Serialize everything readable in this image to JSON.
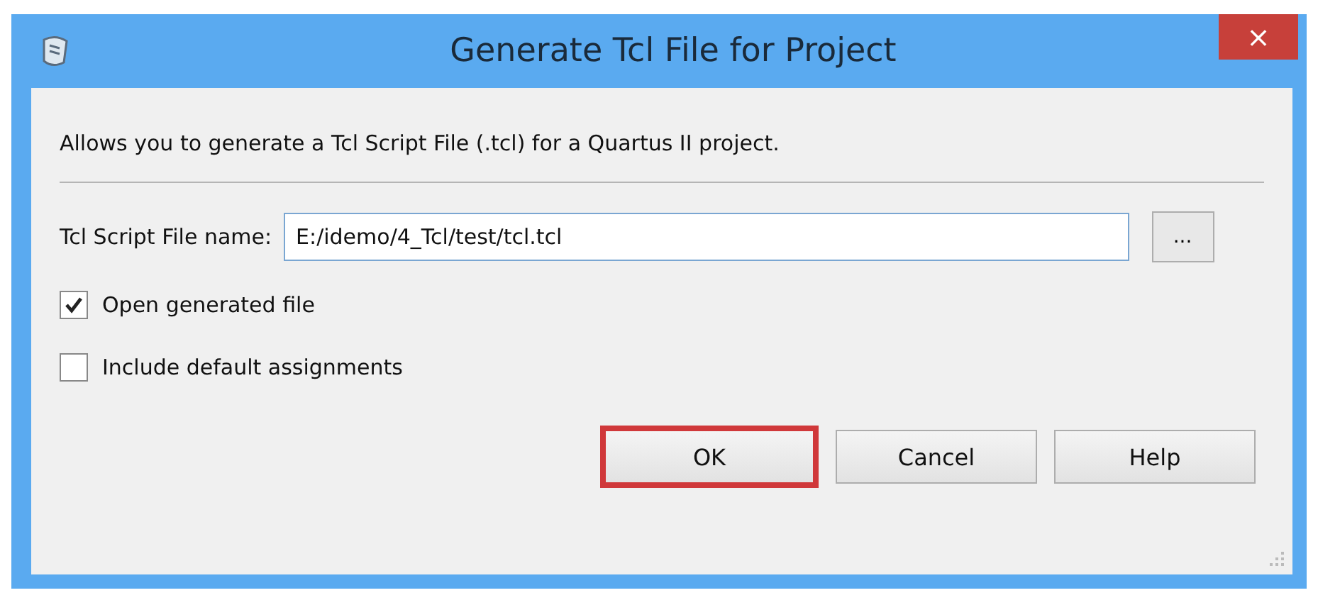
{
  "window": {
    "title": "Generate Tcl File for Project",
    "close": "×"
  },
  "description": "Allows you to generate a Tcl Script File (.tcl) for a Quartus II project.",
  "file_field": {
    "label": "Tcl Script File name:",
    "value": "E:/idemo/4_Tcl/test/tcl.tcl",
    "browse": "..."
  },
  "options": [
    {
      "label": "Open generated file",
      "checked": true
    },
    {
      "label": "Include default assignments",
      "checked": false
    }
  ],
  "buttons": [
    {
      "label": "OK",
      "highlighted": true
    },
    {
      "label": "Cancel",
      "highlighted": false
    },
    {
      "label": "Help",
      "highlighted": false
    }
  ]
}
